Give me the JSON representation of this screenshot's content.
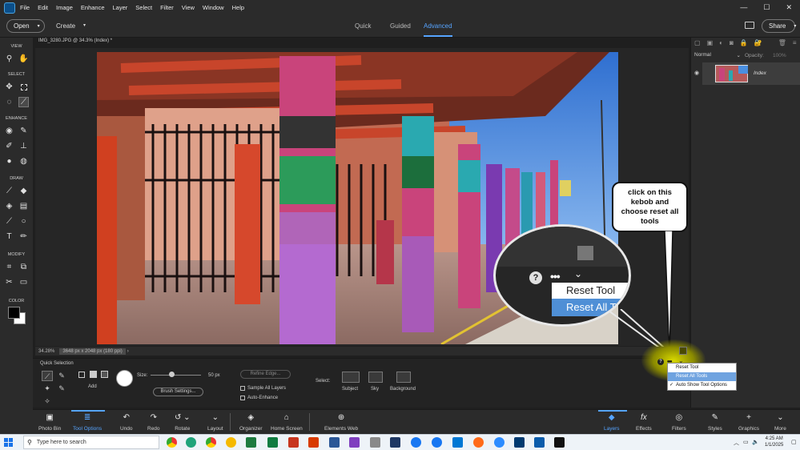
{
  "menubar": {
    "items": [
      "File",
      "Edit",
      "Image",
      "Enhance",
      "Layer",
      "Select",
      "Filter",
      "View",
      "Window",
      "Help"
    ],
    "window_controls": [
      "—",
      "☐",
      "✕"
    ]
  },
  "toolbar": {
    "open_label": "Open",
    "create_label": "Create",
    "modes": [
      "Quick",
      "Guided",
      "Advanced"
    ],
    "active_mode": "Advanced",
    "share_label": "Share"
  },
  "tools_panel": {
    "sections": [
      "VIEW",
      "SELECT",
      "ENHANCE",
      "DRAW",
      "MODIFY",
      "COLOR"
    ],
    "foreground_color": "#000000",
    "background_color": "#ffffff"
  },
  "document": {
    "tab_title": "IMG_3280.JPG @ 34.3% (Index) *",
    "zoom": "34.28%",
    "info": "3648 px x 2048 px (180 ppi)"
  },
  "layers_panel": {
    "blend_mode": "Normal",
    "opacity_label": "Opacity:",
    "opacity_value": "100%",
    "layer_name": "Index"
  },
  "tool_options": {
    "tool_name": "Quick Selection",
    "add_label": "Add",
    "size_label": "Size:",
    "size_value": "50 px",
    "refine_edge_label": "Refine Edge...",
    "brush_settings_label": "Brush Settings...",
    "sample_all_layers_label": "Sample All Layers",
    "auto_enhance_label": "Auto-Enhance",
    "select_label": "Select:",
    "subject_label": "Subject",
    "sky_label": "Sky",
    "background_label": "Background"
  },
  "panel_bin": {
    "left_buttons": [
      "Photo Bin",
      "Tool Options",
      "Undo",
      "Redo",
      "Rotate",
      "Layout",
      "Organizer",
      "Home Screen",
      "Elements Web"
    ],
    "active_left": "Tool Options",
    "right_buttons": [
      "Layers",
      "Effects",
      "Filters",
      "Styles",
      "Graphics",
      "More"
    ],
    "active_right": "Layers"
  },
  "callout": {
    "text": "click on this kebob and choose reset all tools",
    "zoom_item1": "Reset Tool",
    "zoom_item2": "Reset All T"
  },
  "dropdown_menu": {
    "items": [
      "Reset Tool",
      "Reset All Tools",
      "Auto Show Tool Options"
    ],
    "highlighted": "Reset All Tools",
    "checked": "Auto Show Tool Options"
  },
  "taskbar": {
    "search_placeholder": "Type here to search",
    "time": "4:25 AM",
    "date": "1/1/2025"
  },
  "colors": {
    "accent": "#56a4ff",
    "highlight_yellow": "#e6e600",
    "menu_selection": "#6fa3e0"
  }
}
